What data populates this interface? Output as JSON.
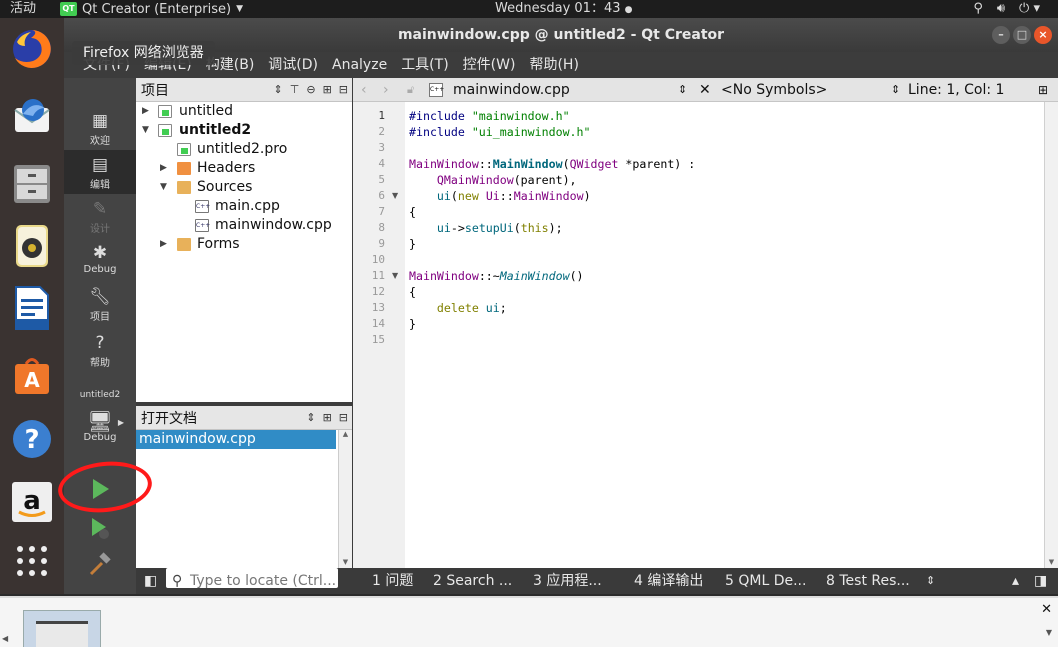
{
  "top_panel": {
    "activities": "活动",
    "app_name": "Qt Creator (Enterprise)",
    "clock": "Wednesday 01：43",
    "sys_icons": [
      "network-icon",
      "volume-icon",
      "power-icon"
    ]
  },
  "dock": {
    "tooltip": "Firefox 网络浏览器",
    "items": [
      "firefox-icon",
      "thunderbird-icon",
      "files-icon",
      "rhythmbox-icon",
      "writer-icon",
      "software-icon",
      "help-icon",
      "amazon-icon",
      "app-grid-icon"
    ]
  },
  "window": {
    "title": "mainwindow.cpp @ untitled2 - Qt Creator",
    "menu": [
      "文件(F)",
      "编辑(E)",
      "构建(B)",
      "调试(D)",
      "Analyze",
      "工具(T)",
      "控件(W)",
      "帮助(H)"
    ]
  },
  "modes": {
    "welcome": "欢迎",
    "edit": "编辑",
    "design": "设计",
    "debug": "Debug",
    "projects": "项目",
    "help": "帮助",
    "kit_project": "untitled2",
    "kit_mode": "Debug"
  },
  "project_panel": {
    "title": "项目",
    "tree": [
      {
        "label": "untitled",
        "bold": false
      },
      {
        "label": "untitled2",
        "bold": true
      },
      {
        "label": "untitled2.pro",
        "bold": false
      },
      {
        "label": "Headers",
        "bold": false
      },
      {
        "label": "Sources",
        "bold": false
      },
      {
        "label": "main.cpp",
        "bold": false
      },
      {
        "label": "mainwindow.cpp",
        "bold": false
      },
      {
        "label": "Forms",
        "bold": false
      }
    ]
  },
  "docs_panel": {
    "title": "打开文档",
    "items": [
      "mainwindow.cpp"
    ]
  },
  "editor": {
    "filename": "mainwindow.cpp",
    "symbols": "<No Symbols>",
    "position": "Line: 1, Col: 1",
    "lines": [
      "1",
      "2",
      "3",
      "4",
      "5",
      "6",
      "7",
      "8",
      "9",
      "10",
      "11",
      "12",
      "13",
      "14",
      "15"
    ]
  },
  "status_bar": {
    "locate_placeholder": "Type to locate (Ctrl...",
    "tabs": [
      "1 问题",
      "2 Search ...",
      "3 应用程...",
      "4 编译输出",
      "5 QML De...",
      "8 Test Res..."
    ]
  }
}
